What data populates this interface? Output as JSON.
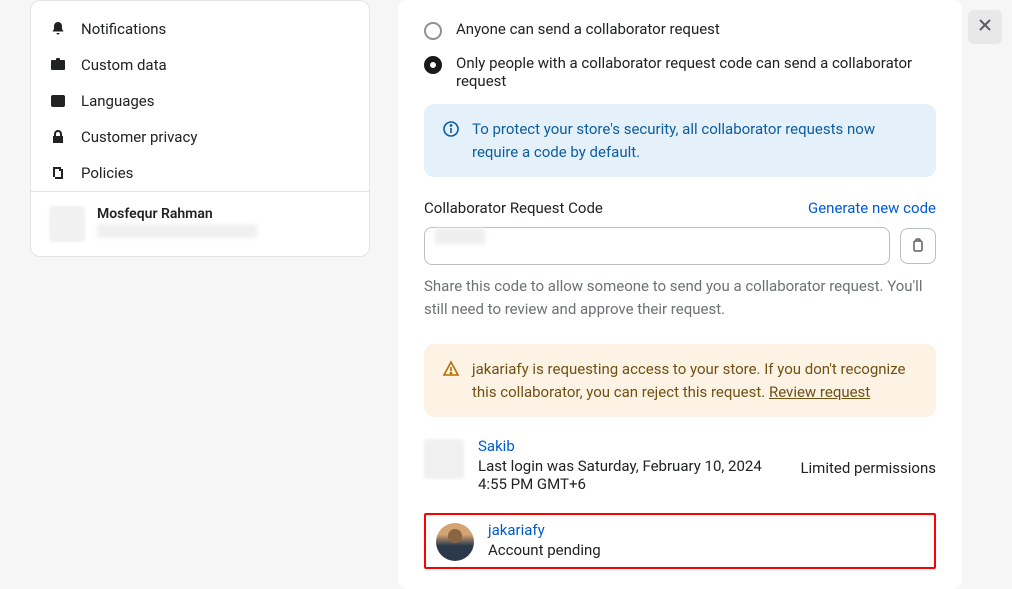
{
  "sidebar": {
    "items": [
      {
        "label": "Notifications"
      },
      {
        "label": "Custom data"
      },
      {
        "label": "Languages"
      },
      {
        "label": "Customer privacy"
      },
      {
        "label": "Policies"
      }
    ],
    "footer": {
      "name": "Mosfequr Rahman"
    }
  },
  "main": {
    "radio1": "Anyone can send a collaborator request",
    "radio2": "Only people with a collaborator request code can send a collaborator request",
    "info_banner": "To protect your store's security, all collaborator requests now require a code by default.",
    "code_label": "Collaborator Request Code",
    "generate_link": "Generate new code",
    "help_text": "Share this code to allow someone to send you a collaborator request. You'll still need to review and approve their request.",
    "warning_text": "jakariafy is requesting access to your store. If you don't recognize this collaborator, you can reject this request. ",
    "review_link": "Review request",
    "collaborators": [
      {
        "name": "Sakib",
        "status": "Last login was Saturday, February 10, 2024 4:55 PM GMT+6",
        "permissions": "Limited permissions"
      },
      {
        "name": "jakariafy",
        "status": "Account pending"
      }
    ]
  }
}
